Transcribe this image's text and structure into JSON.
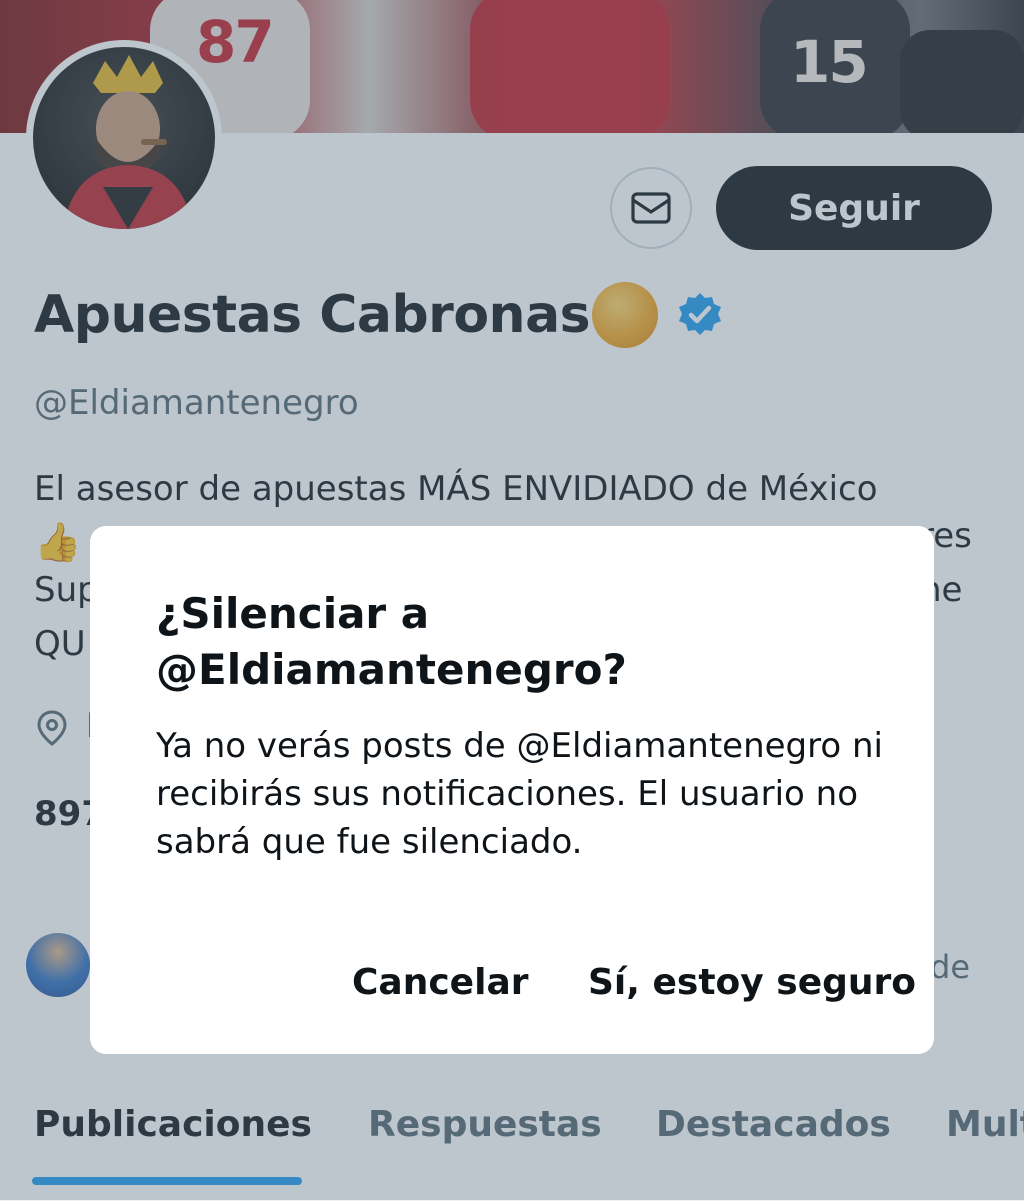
{
  "profile": {
    "display_name": "Apuestas Cabronas",
    "handle": "@Eldiamantenegro",
    "follow_label": "Seguir",
    "message_icon": "envelope-icon",
    "verified_icon": "verified-badge-icon",
    "bio_line1": "El asesor de apuestas MÁS ENVIDIADO de México",
    "bio_line2_tail": "res",
    "bio_line3_head": "Sup",
    "bio_line3_tail": "ne",
    "bio_line4_head": "QU",
    "location_icon": "location-pin-icon",
    "location_text_fragment": "I",
    "stat_fragment": "897",
    "followers_text_tail": "de",
    "banner_numbers": [
      "87",
      "15"
    ]
  },
  "dialog": {
    "title": "¿Silenciar a @Eldiamantenegro?",
    "body": "Ya no verás posts de @Eldiamantenegro ni recibirás sus notificaciones. El usuario no sabrá que fue silenciado.",
    "cancel_label": "Cancelar",
    "confirm_label": "Sí, estoy seguro"
  },
  "tabs": [
    {
      "label": "Publicaciones",
      "active": true
    },
    {
      "label": "Respuestas",
      "active": false
    },
    {
      "label": "Destacados",
      "active": false
    },
    {
      "label": "Mult",
      "active": false
    }
  ],
  "colors": {
    "accent": "#1d9bf0",
    "text_primary": "#0f1419",
    "text_secondary": "#536471",
    "overlay": "rgba(91,112,131,0.40)"
  }
}
